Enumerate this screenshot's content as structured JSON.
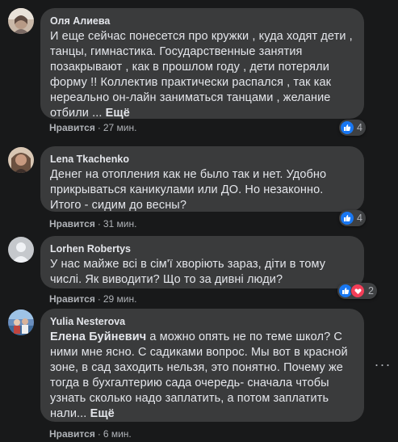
{
  "comments": [
    {
      "author": "Оля Алиева",
      "text": "И еще сейчас понесется про кружки , куда ходят дети , танцы, гимнастика. Государственные занятия позакрывают , как в прошлом году , дети потеряли форму !! Коллектив практически распался , так как нереально он-лайн заниматься танцами , желание отбили ...",
      "more_label": "Ещё",
      "like_label": "Нравится",
      "time": "27 мин.",
      "reaction_count": "4"
    },
    {
      "author": "Lena Tkachenko",
      "text": "Денег на отопления как не было так и нет. Удобно прикрываться каникулами или ДО. Но незаконно. Итого - сидим до весны?",
      "like_label": "Нравится",
      "time": "31 мин.",
      "reaction_count": "4"
    },
    {
      "author": "Lorhen Robertys",
      "text": "У нас майже всі в сім'ї хворіють зараз, діти в тому числі. Як виводити? Що то за дивні люди?",
      "like_label": "Нравится",
      "time": "29 мин.",
      "reaction_count": "2"
    },
    {
      "author": "Yulia Nesterova",
      "mention": "Елена Буйневич",
      "text": " а можно опять не по теме школ? С ними мне ясно. С садиками вопрос. Мы вот в красной зоне, в сад заходить нельзя, это понятно. Почему же тогда в бухгалтерию сада очередь- сначала чтобы узнать сколько надо заплатить, а потом заплатить нали...",
      "more_label": "Ещё",
      "like_label": "Нравится",
      "time": "6 мин."
    }
  ],
  "separator": "·",
  "more_options_label": "···",
  "colors": {
    "background": "#18191a",
    "bubble": "#3a3b3c",
    "text": "#e4e6eb",
    "secondary": "#b0b3b8",
    "like_blue": "#1877f2",
    "love_red": "#f33e58"
  }
}
